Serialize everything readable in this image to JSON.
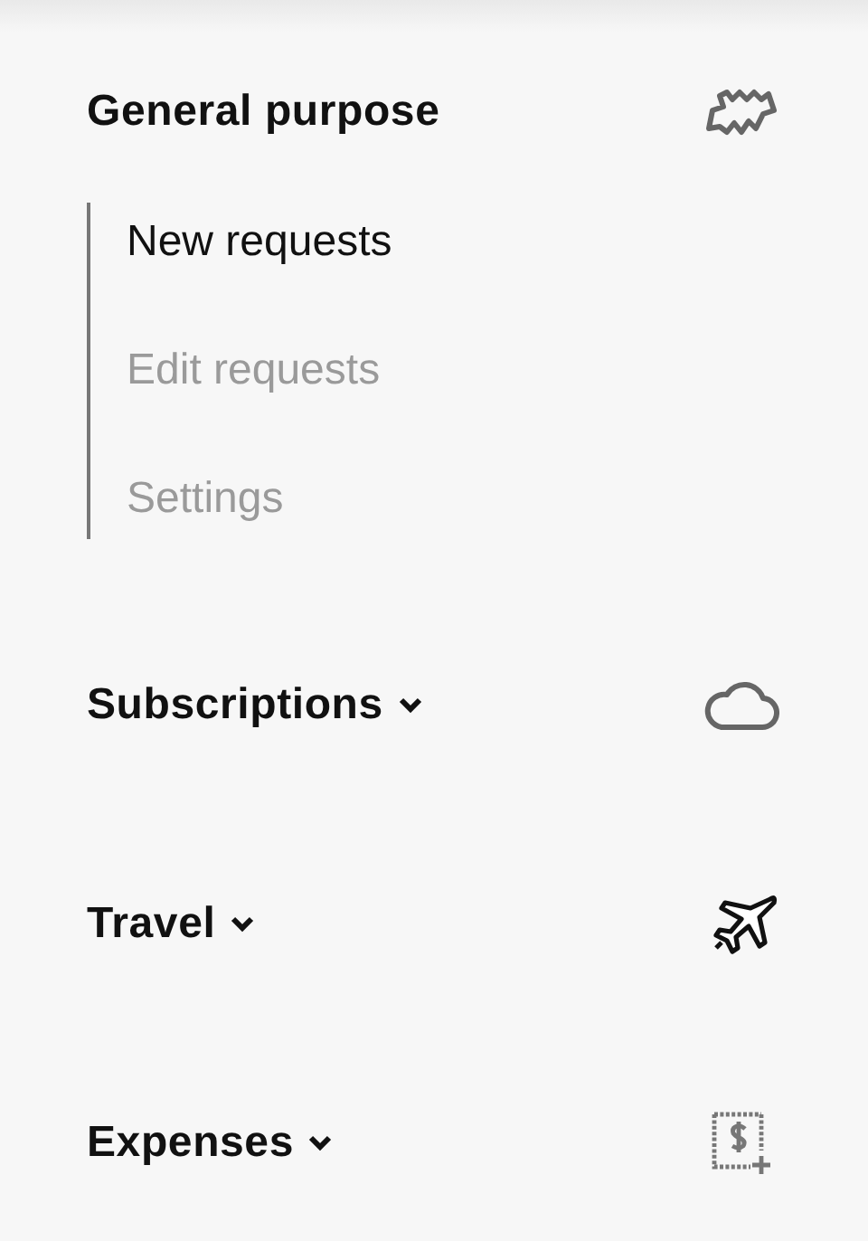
{
  "sections": [
    {
      "title": "General purpose",
      "kind": "zigzag",
      "expanded": true,
      "children": [
        {
          "label": "New requests",
          "selected": true
        },
        {
          "label": "Edit requests",
          "selected": false
        },
        {
          "label": "Settings",
          "selected": false
        }
      ]
    },
    {
      "title": "Subscriptions",
      "kind": "cloud",
      "expanded": false
    },
    {
      "title": "Travel",
      "kind": "plane",
      "expanded": false
    },
    {
      "title": "Expenses",
      "kind": "receipt",
      "expanded": false
    }
  ]
}
